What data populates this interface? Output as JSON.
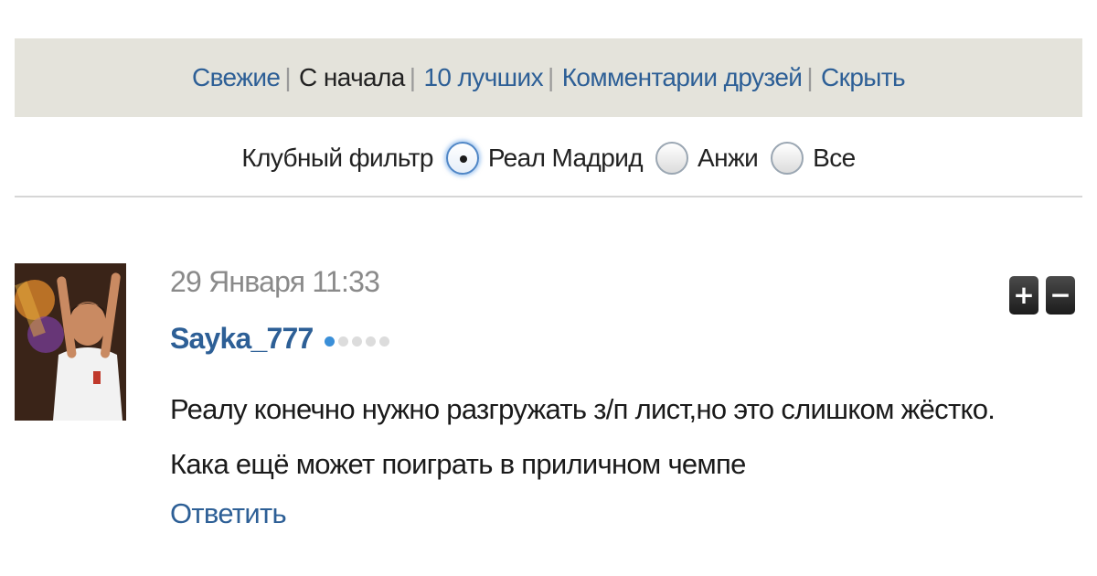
{
  "sort_bar": {
    "items": [
      {
        "label": "Свежие",
        "active": false
      },
      {
        "label": "С начала",
        "active": true
      },
      {
        "label": "10 лучших",
        "active": false
      },
      {
        "label": "Комментарии друзей",
        "active": false
      },
      {
        "label": "Скрыть",
        "active": false
      }
    ],
    "separator": "|"
  },
  "club_filter": {
    "label": "Клубный фильтр",
    "options": [
      {
        "label": "Реал Мадрид",
        "selected": true
      },
      {
        "label": "Анжи",
        "selected": false
      },
      {
        "label": "Все",
        "selected": false
      }
    ]
  },
  "comment": {
    "date": "29 Января 11:33",
    "author": "Sayka_777",
    "rating_level": 1,
    "rating_max": 5,
    "text": "Реалу конечно нужно разгружать з/п лист,но это слишком жёстко. Кака ещё может поиграть в приличном чемпе",
    "reply_label": "Ответить",
    "vote_plus": "+",
    "vote_minus": "−"
  },
  "colors": {
    "link": "#2d5f96",
    "bar_background": "#e4e3db",
    "rating_active": "#3a8fd8"
  }
}
